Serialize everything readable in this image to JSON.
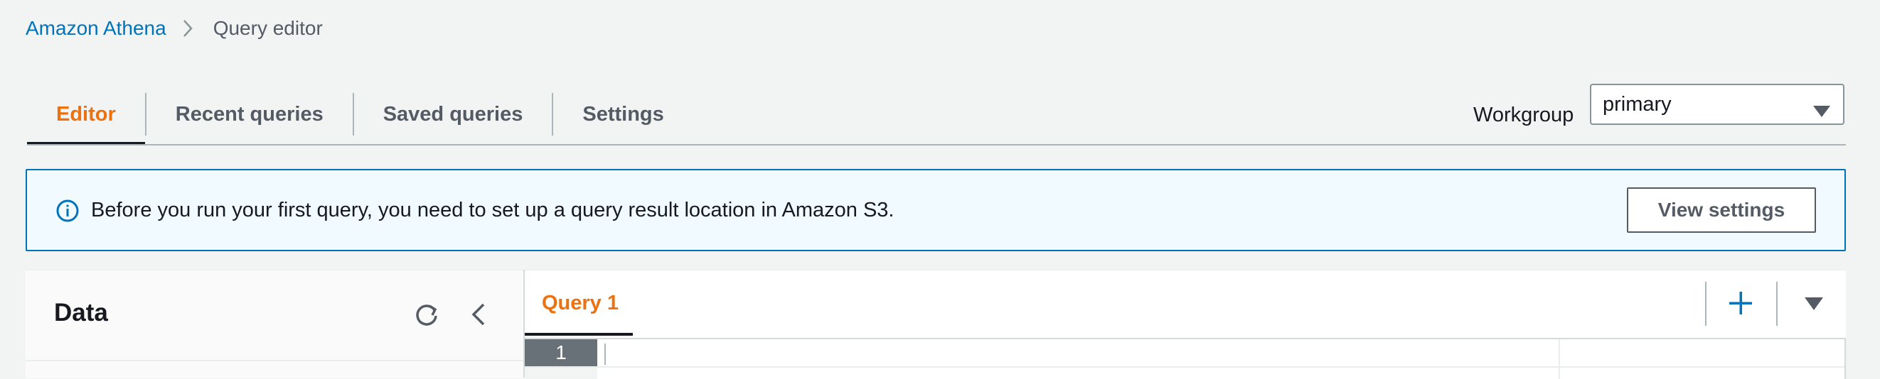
{
  "breadcrumb": {
    "service": "Amazon Athena",
    "current": "Query editor"
  },
  "tabs": [
    {
      "label": "Editor",
      "active": true
    },
    {
      "label": "Recent queries",
      "active": false
    },
    {
      "label": "Saved queries",
      "active": false
    },
    {
      "label": "Settings",
      "active": false
    }
  ],
  "workgroup": {
    "label": "Workgroup",
    "selected": "primary"
  },
  "alert": {
    "message": "Before you run your first query, you need to set up a query result location in Amazon S3.",
    "button_label": "View settings"
  },
  "data_panel": {
    "title": "Data"
  },
  "query_editor": {
    "tab_label": "Query 1",
    "line_number": "1"
  },
  "colors": {
    "accent": "#ec7211",
    "link": "#0073bb",
    "info_bg": "#f1faff"
  },
  "icons": [
    "chevron-right-icon",
    "caret-down-icon",
    "info-icon",
    "refresh-icon",
    "chevron-left-icon",
    "plus-icon"
  ]
}
